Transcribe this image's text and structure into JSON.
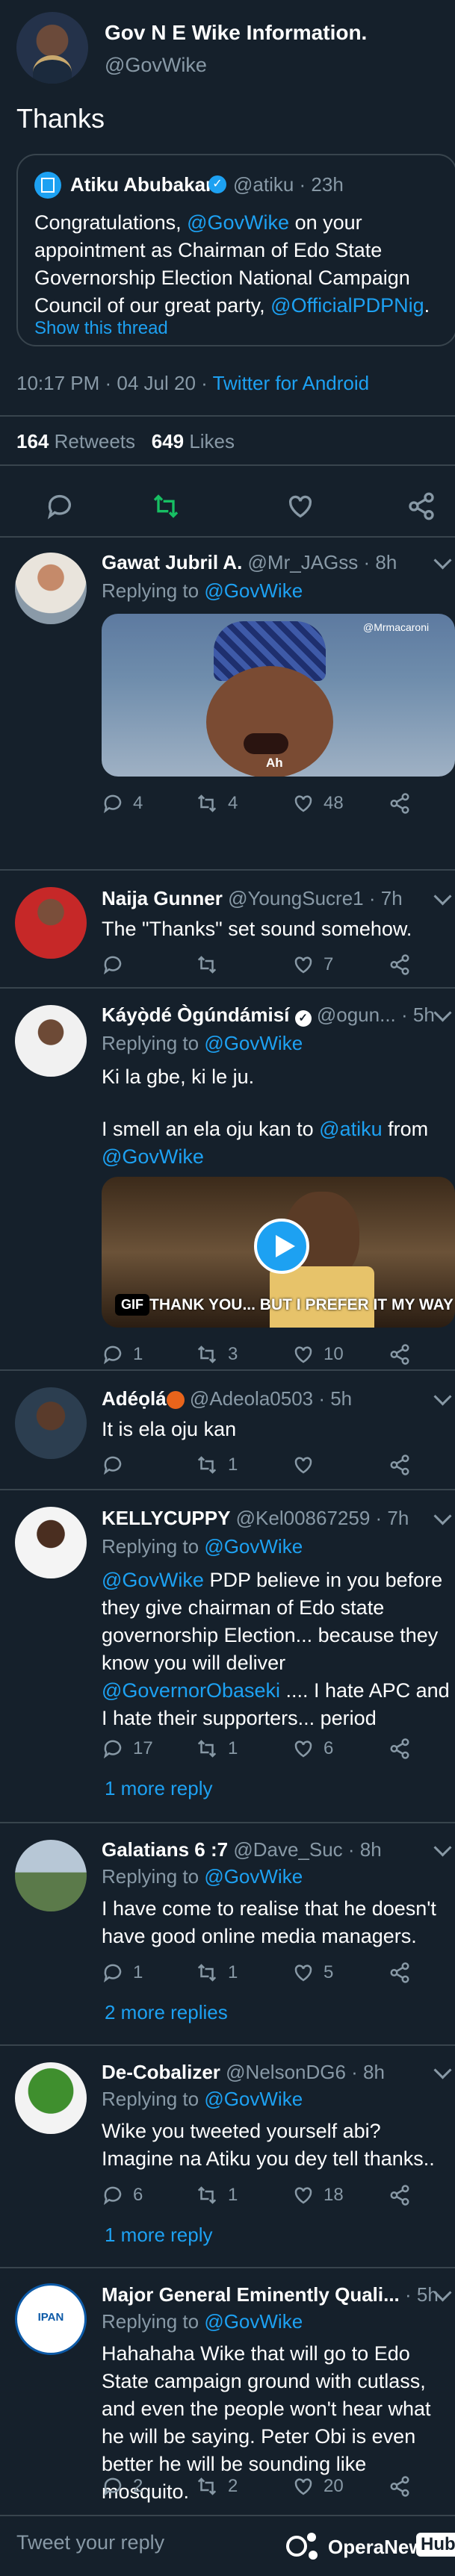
{
  "main": {
    "name": "Gov N E Wike Information.",
    "handle": "@GovWike",
    "text": "Thanks",
    "quote": {
      "name": "Atiku Abubakar",
      "handle": "@atiku · 23h",
      "text_parts": [
        "Congratulations, ",
        "@GovWike",
        " on your appointment as Chairman of Edo State Governorship Election National Campaign Council of our great party, ",
        "@OfficialPDPNig",
        "."
      ],
      "show_thread": "Show this thread"
    },
    "time": "10:17 PM · 04 Jul 20 · ",
    "source": "Twitter for Android",
    "retweets_count": "164",
    "retweets_label": "Retweets",
    "likes_count": "649",
    "likes_label": "Likes"
  },
  "replies": [
    {
      "name": "Gawat Jubril A.",
      "handle": "@Mr_JAGss · 8h",
      "replying": "Replying to",
      "replying_to": "@GovWike",
      "media_caption": "Ah",
      "media_watermark": "@Mrmacaroni",
      "reply_count": "4",
      "retweet_count": "4",
      "like_count": "48"
    },
    {
      "name": "Naija Gunner",
      "handle": "@YoungSucre1 · 7h",
      "text": "The \"Thanks\" set sound somehow.",
      "reply_count": "",
      "retweet_count": "",
      "like_count": "7"
    },
    {
      "name": "Káyọ̀dé Ògúndámisí",
      "handle": "@ogun... · 5h",
      "replying": "Replying to",
      "replying_to": "@GovWike",
      "text1": "Ki la gbe, ki le ju.",
      "text2_parts": [
        "I smell an ela oju kan to ",
        "@atiku",
        " from ",
        "@GovWike"
      ],
      "gif_label": "GIF",
      "gif_caption": "THANK YOU... BUT I PREFER IT MY WAY",
      "reply_count": "1",
      "retweet_count": "3",
      "like_count": "10"
    },
    {
      "name": "Adéọlá",
      "handle": "@Adeola0503 · 5h",
      "text": "It is ela oju kan",
      "reply_count": "",
      "retweet_count": "1",
      "like_count": ""
    },
    {
      "name": "KELLYCUPPY",
      "handle": "@Kel00867259 · 7h",
      "replying": "Replying to",
      "replying_to": "@GovWike",
      "text_parts": [
        "@GovWike",
        " PDP believe in you before they give chairman of Edo state governorship Election... because they know you will deliver ",
        "@GovernorObaseki",
        " .... I hate APC and I hate their supporters... period"
      ],
      "reply_count": "17",
      "retweet_count": "1",
      "like_count": "6",
      "more": "1 more reply"
    },
    {
      "name": "Galatians 6 :7",
      "handle": "@Dave_Suc · 8h",
      "replying": "Replying to",
      "replying_to": "@GovWike",
      "text": "I have come to realise that he doesn't have good online media managers.",
      "reply_count": "1",
      "retweet_count": "1",
      "like_count": "5",
      "more": "2 more replies"
    },
    {
      "name": "De-Cobalizer",
      "handle": "@NelsonDG6 · 8h",
      "replying": "Replying to",
      "replying_to": "@GovWike",
      "text": "Wike you tweeted yourself abi? Imagine na Atiku you dey tell thanks..",
      "reply_count": "6",
      "retweet_count": "1",
      "like_count": "18",
      "more": "1 more reply"
    },
    {
      "name": "Major General Eminently Quali...",
      "handle": "· 5h",
      "replying": "Replying to",
      "replying_to": "@GovWike",
      "avatar_text": "IPAN",
      "text": "Hahahaha Wike that will go to Edo State campaign ground with cutlass, and even the people won't hear what he will be saying. Peter Obi is even better he will be sounding like mosquito.",
      "reply_count": "2",
      "retweet_count": "2",
      "like_count": "20"
    }
  ],
  "footer": {
    "placeholder": "Tweet your reply",
    "watermark": "OperaNews",
    "watermark_hub": "Hub"
  },
  "colors": {
    "background": "#15202b",
    "accent": "#1da1f2",
    "muted": "#8899a6",
    "retweet_green": "#17bf63",
    "divider": "#38444d"
  }
}
